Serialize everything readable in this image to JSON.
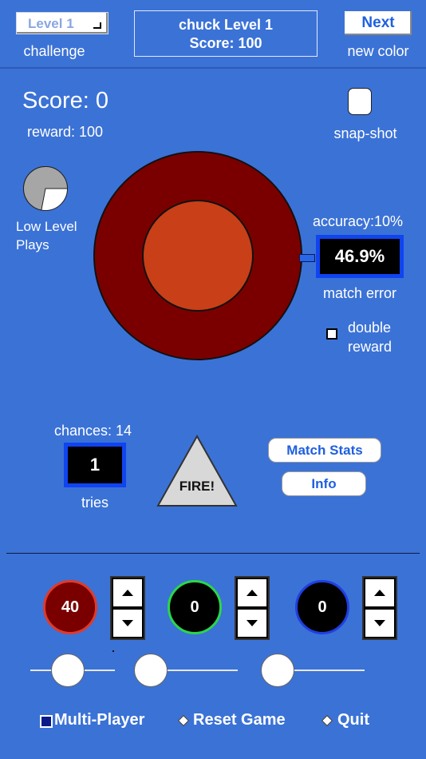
{
  "header": {
    "level_select": "Level 1",
    "challenge_label": "challenge",
    "title_line1": "chuck Level 1",
    "title_line2": "Score: 100",
    "next_label": "Next",
    "new_color_label": "new color"
  },
  "game": {
    "score_label": "Score: 0",
    "reward_label": "reward: 100",
    "snapshot_label": "snap-shot",
    "low_level_line1": "Low Level",
    "low_level_line2": "Plays",
    "low_level_fraction": 0.72,
    "accuracy_label": "accuracy:",
    "accuracy_value": "10%",
    "match_error_value": "46.9%",
    "match_error_label": "match error",
    "double_reward_line1": "double",
    "double_reward_line2": "reward",
    "chances_label": "chances: 14",
    "tries_value": "1",
    "tries_label": "tries",
    "fire_label": "FIRE!",
    "match_stats_label": "Match Stats",
    "info_label": "Info",
    "target_outer_color": "#7a0000",
    "target_inner_color": "#c93f17"
  },
  "mixer": {
    "channels": [
      {
        "value": "40",
        "color": "#7a0000",
        "ring": "#e03a2a",
        "slider": 0.4
      },
      {
        "value": "0",
        "color": "#000000",
        "ring": "#2bd64a",
        "slider": 0.0
      },
      {
        "value": "0",
        "color": "#000000",
        "ring": "#1f3fe0",
        "slider": 0.0
      }
    ]
  },
  "footer": {
    "multi_player": "Multi-Player",
    "reset_game": "Reset Game",
    "quit": "Quit"
  }
}
